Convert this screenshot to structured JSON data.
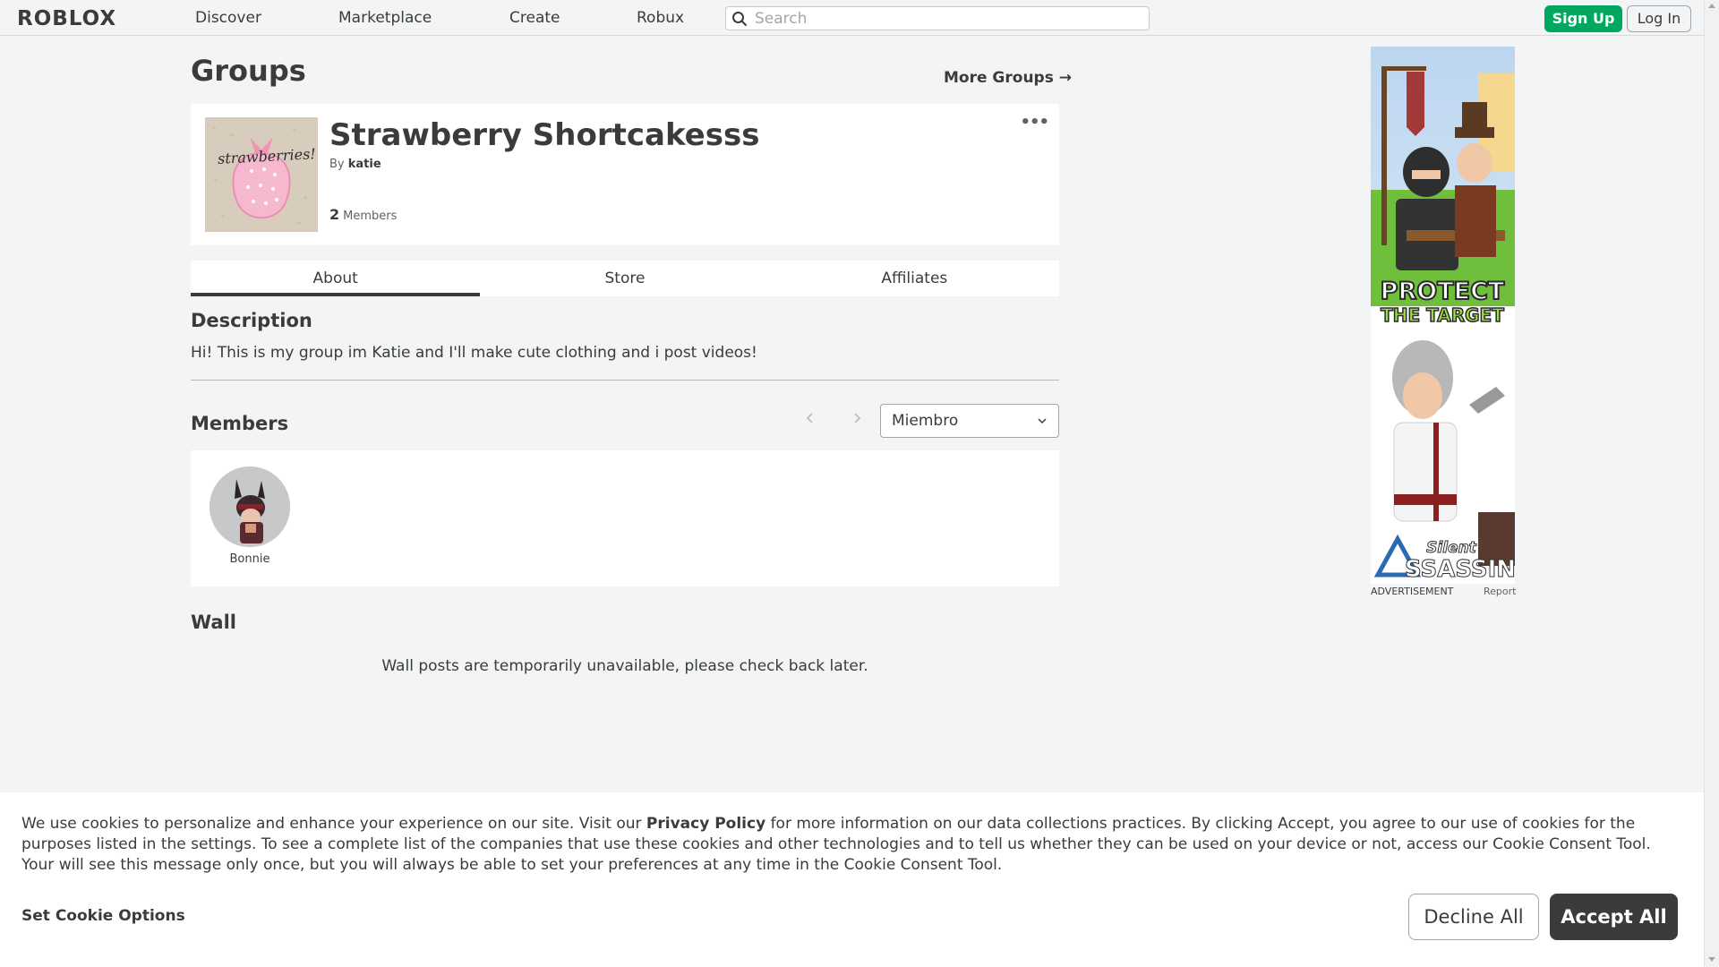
{
  "header": {
    "logo": "ROBLOX",
    "nav": [
      "Discover",
      "Marketplace",
      "Create",
      "Robux"
    ],
    "search_placeholder": "Search",
    "signup_label": "Sign Up",
    "login_label": "Log In"
  },
  "page": {
    "title": "Groups",
    "more_groups": "More Groups →"
  },
  "group": {
    "name": "Strawberry Shortcakesss",
    "by_prefix": "By",
    "owner": "katie",
    "member_count": "2",
    "member_label": "Members",
    "thumb_text": "strawberries!",
    "menu_icon": "•••"
  },
  "tabs": [
    "About",
    "Store",
    "Affiliates"
  ],
  "about": {
    "description_heading": "Description",
    "description": "Hi! This is my group im Katie and I'll make cute clothing and i post videos!"
  },
  "members": {
    "heading": "Members",
    "role_selected": "Miembro",
    "list": [
      {
        "name": "Bonnie"
      }
    ]
  },
  "wall": {
    "heading": "Wall",
    "message": "Wall posts are temporarily unavailable, please check back later."
  },
  "ad": {
    "headline_1": "PROTECT",
    "headline_2": "THE TARGET",
    "brand_1": "Silent",
    "brand_2": "SSASSIN",
    "label": "ADVERTISEMENT",
    "report": "Report"
  },
  "cookie": {
    "text_before_link": "We use cookies to personalize and enhance your experience on our site. Visit our ",
    "link": "Privacy Policy",
    "text_after_link": " for more information on our data collections practices. By clicking Accept, you agree to our use of cookies for the purposes listed in the settings. To see a complete list of the companies that use these cookies and other technologies and to tell us whether they can be used on your device or not, access our Cookie Consent Tool. Your will see this message only once, but you will always be able to set your preferences at any time in the Cookie Consent Tool.",
    "set_options": "Set Cookie Options",
    "decline": "Decline All",
    "accept": "Accept All"
  },
  "colors": {
    "brand_green": "#00a85f",
    "background": "#f2f4f5",
    "text": "#393b3d",
    "accept_bg": "#393b3d"
  }
}
